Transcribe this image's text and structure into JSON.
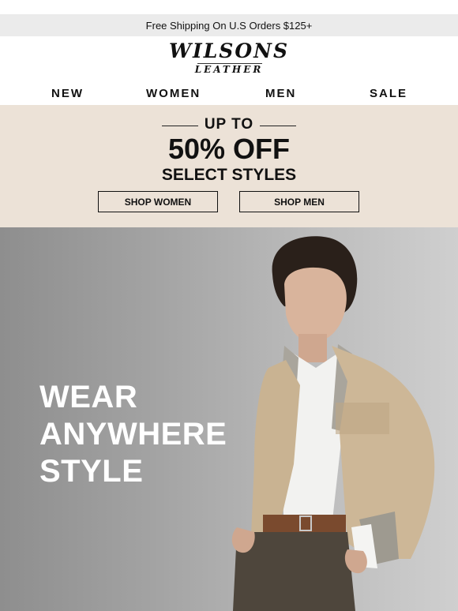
{
  "topbar": {
    "text": "Free Shipping On U.S Orders $125+"
  },
  "logo": {
    "main": "WILSONS",
    "sub": "LEATHER"
  },
  "nav": {
    "items": [
      "NEW",
      "WOMEN",
      "MEN",
      "SALE"
    ]
  },
  "promo": {
    "up_to": "UP TO",
    "headline": "50% OFF",
    "subline": "SELECT STYLES",
    "shop_women": "SHOP WOMEN",
    "shop_men": "SHOP MEN",
    "background": "#ece2d7"
  },
  "hero": {
    "lines": [
      "WEAR",
      "ANYWHERE",
      "STYLE"
    ],
    "text_color": "#ffffff"
  }
}
